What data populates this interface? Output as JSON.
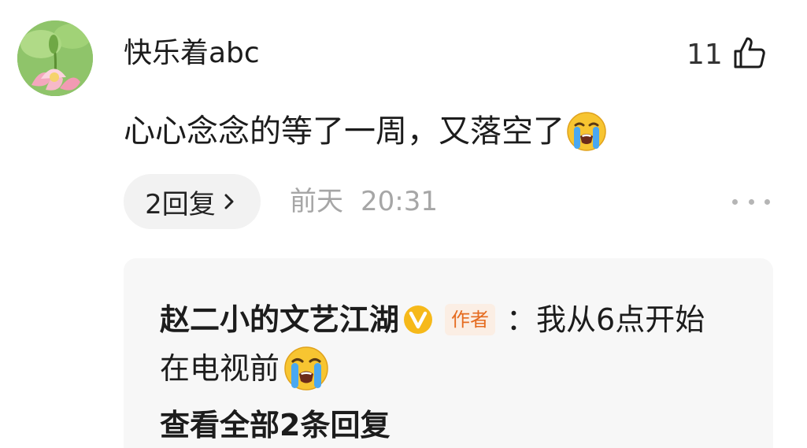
{
  "comment": {
    "username": "快乐着abc",
    "like_count": "11",
    "text": "心心念念的等了一周，又落空了",
    "text_emoji": "crying-face-icon",
    "replies_label": "2回复",
    "time_day": "前天",
    "time_clock": "20:31"
  },
  "reply_preview": {
    "author": "赵二小的文艺江湖",
    "author_tag": "作者",
    "colon": "：",
    "text_line1": "我从6点开始",
    "text_line2": "在电视前",
    "text_emoji": "crying-face-icon",
    "view_all_label": "查看全部2条回复"
  },
  "icons": {
    "like": "thumbs-up-icon",
    "more": "more-dots-icon",
    "verified": "verified-v-badge-icon",
    "chevron": "chevron-right-icon"
  },
  "colors": {
    "pill_bg": "#f2f2f2",
    "reply_bg": "#f7f7f7",
    "muted_text": "#a6a6a6",
    "author_tag_text": "#e56b1f",
    "author_tag_bg": "#fbeee4",
    "verified_badge": "#f6b91a"
  }
}
